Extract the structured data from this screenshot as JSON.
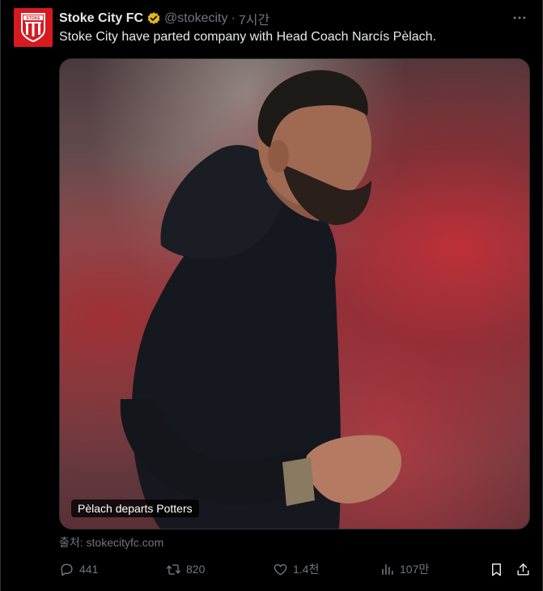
{
  "author": {
    "name": "Stoke City FC",
    "handle": "@stokecity",
    "separator": "·",
    "time": "7시간",
    "avatar_text": "STOKE",
    "verified_color": "#e2b719",
    "avatar_color": "#d71920"
  },
  "tweet": {
    "text": "Stoke City have parted company with Head Coach Narcís Pèlach."
  },
  "media": {
    "caption": "Pèlach departs Potters"
  },
  "source": {
    "text": "출처: stokecityfc.com"
  },
  "actions": {
    "replies": "441",
    "retweets": "820",
    "likes": "1.4천",
    "views": "107만"
  },
  "icons": {
    "more": "more-icon",
    "reply": "reply-icon",
    "retweet": "retweet-icon",
    "like": "like-icon",
    "views": "views-icon",
    "bookmark": "bookmark-icon",
    "share": "share-icon"
  }
}
